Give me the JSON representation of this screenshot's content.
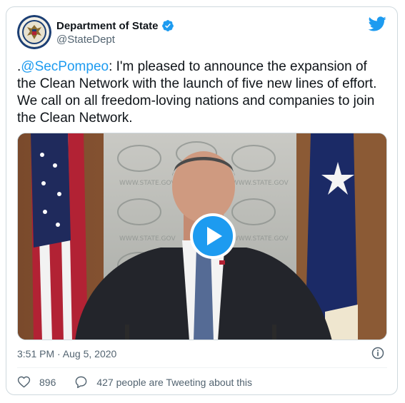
{
  "account": {
    "name": "Department of State",
    "handle": "@StateDept",
    "verified": true,
    "avatar_icon": "department-of-state-seal-icon"
  },
  "tweet": {
    "prefix": ".",
    "mention": "@SecPompeo",
    "body": ": I'm pleased to announce the expansion of the Clean Network with the launch of five new lines of effort. We call on all freedom-loving nations and companies to join the Clean Network."
  },
  "media": {
    "type": "video",
    "backdrop_text": "WWW.STATE.GOV",
    "play_icon": "play-icon"
  },
  "meta": {
    "timestamp": "3:51 PM · Aug 5, 2020"
  },
  "engagement": {
    "likes": "896",
    "conversation": "427 people are Tweeting about this"
  },
  "colors": {
    "accent": "#1d9bf0",
    "text": "#0f1419",
    "muted": "#536471",
    "border": "#cfd9de"
  }
}
